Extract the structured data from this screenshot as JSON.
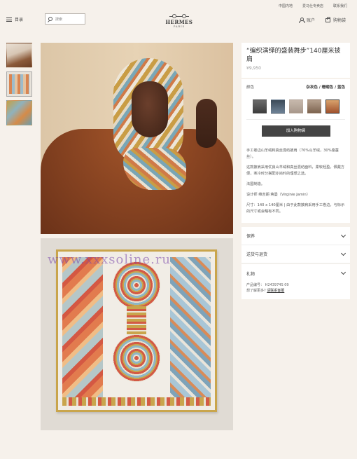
{
  "utility_bar": {
    "links": [
      "中国内地",
      "爱马仕专卖店",
      "联系我们"
    ]
  },
  "header": {
    "menu_label": "目录",
    "search_placeholder": "搜索",
    "logo_text": "HERMES",
    "logo_subtext": "PARIS",
    "account_label": "账户",
    "cart_label": "购物袋"
  },
  "product": {
    "title": "“编织演绎的盛装舞步”140厘米披肩",
    "price": "¥9,950",
    "color_label": "颜色",
    "color_value": "杂灰色 / 珊瑚色 / 蓝色",
    "add_to_cart": "加入购物袋",
    "description": [
      "手工卷边山羊绒和真丝混纺披肩（70%山羊绒，30%桑蚕丝）。",
      "这款披肩采用优良山羊绒和真丝混纺面料，柔软轻盈，佩戴方便，寒冷时分搭配亦尚时的理想之选。",
      "法国制造。",
      "设计师 维吉妮·蒋曼（Virginie Jamin）",
      "尺寸：140 x 140厘米 | 由于此款披肩采用手工卷边，与标示的尺寸或会略有不同。"
    ]
  },
  "accordion": {
    "care": "保养",
    "shipping": "送货与退货",
    "gift": "礼物",
    "ref_label": "产品编号：",
    "ref_value": "H243974S 09",
    "help_text": "想了解更多?",
    "help_link": "请联系客服"
  },
  "watermark": "www.xxxsoline.ru"
}
